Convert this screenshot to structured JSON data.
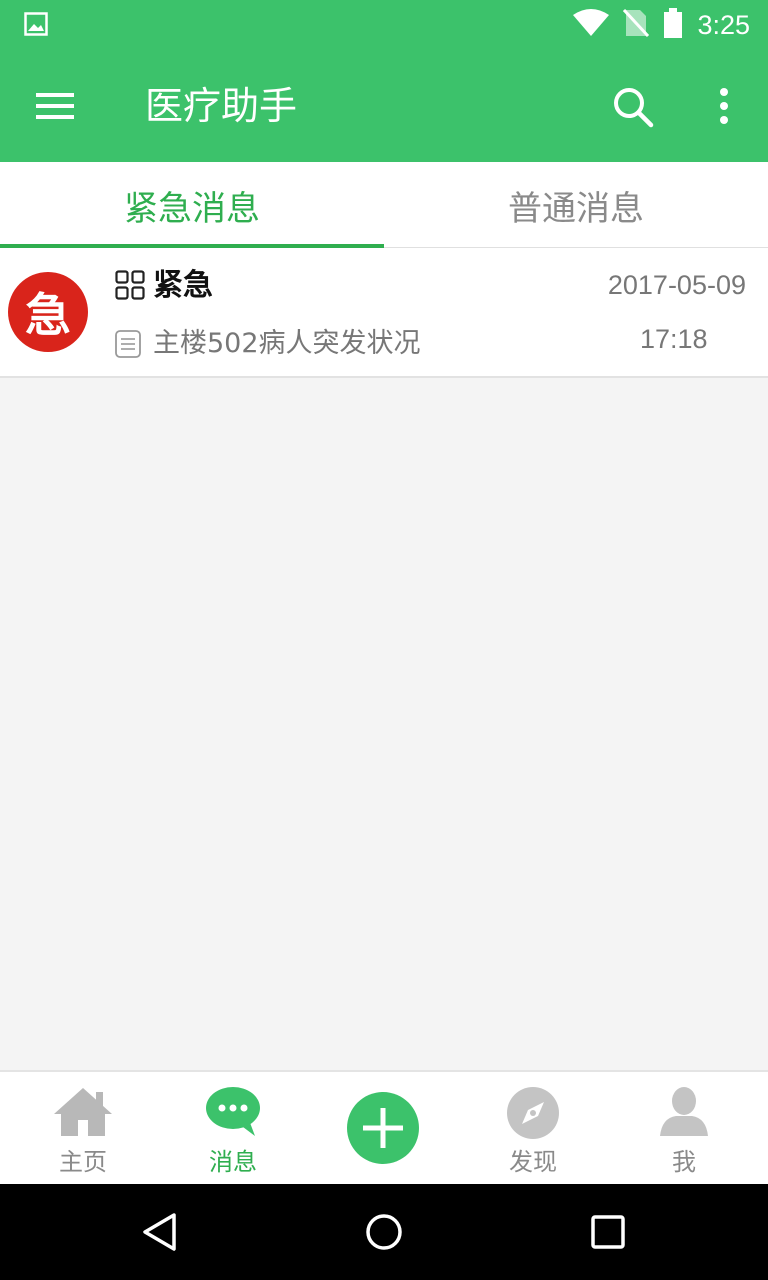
{
  "status_bar": {
    "time": "3:25",
    "icons": [
      "image-notification-icon",
      "wifi-icon",
      "no-sim-icon",
      "battery-icon"
    ]
  },
  "app_bar": {
    "title": "医疗助手",
    "icons": [
      "menu-icon",
      "search-icon",
      "more-vertical-icon"
    ]
  },
  "tabs": [
    {
      "label": "紧急消息",
      "active": true
    },
    {
      "label": "普通消息",
      "active": false
    }
  ],
  "messages": [
    {
      "avatar_text": "急",
      "title": "紧急",
      "preview": "主楼502病人突发状况",
      "date": "2017-05-09",
      "time": "17:18"
    }
  ],
  "bottom_nav": [
    {
      "label": "主页",
      "icon": "home-icon",
      "active": false
    },
    {
      "label": "消息",
      "icon": "chat-bubble-icon",
      "active": true
    },
    {
      "label": "",
      "icon": "add-icon",
      "active": false
    },
    {
      "label": "发现",
      "icon": "compass-icon",
      "active": false
    },
    {
      "label": "我",
      "icon": "person-icon",
      "active": false
    }
  ],
  "colors": {
    "primary": "#3cc26b",
    "accent_text": "#2fae4f",
    "urgent_red": "#d9241b",
    "inactive_text": "#8a8a8a"
  }
}
